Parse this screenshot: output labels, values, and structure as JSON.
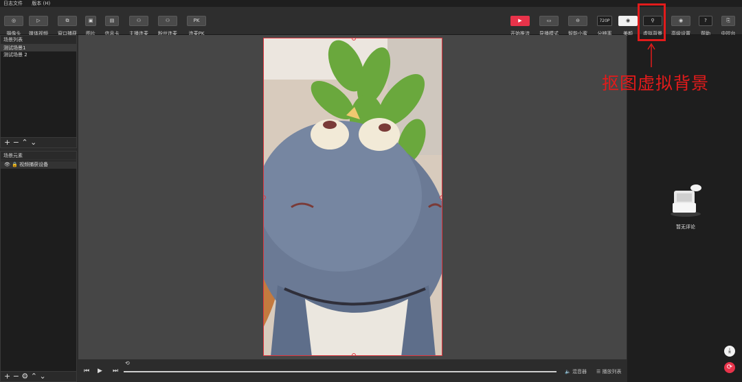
{
  "menu": [
    "日志文件",
    "版本 (H)"
  ],
  "toolbar_left": [
    {
      "label": "摄像头",
      "glyph": "◎"
    },
    {
      "label": "媒体视频",
      "glyph": "▷"
    },
    {
      "label": "窗口捕获",
      "glyph": "⧉"
    },
    {
      "label": "图片",
      "glyph": "▣"
    },
    {
      "label": "信息卡",
      "glyph": "▤"
    },
    {
      "label": "主播连麦",
      "glyph": "⚇"
    },
    {
      "label": "粉丝连麦",
      "glyph": "⚇"
    },
    {
      "label": "连麦PK",
      "glyph": "PK"
    }
  ],
  "toolbar_right": [
    {
      "label": "开始推流",
      "glyph": "▶",
      "style": "red"
    },
    {
      "label": "导播模式",
      "glyph": "▭",
      "style": ""
    },
    {
      "label": "智能小蜜",
      "glyph": "⊖",
      "style": ""
    },
    {
      "label": "分辨率",
      "glyph": "720P",
      "style": "dark"
    },
    {
      "label": "美颜",
      "glyph": "◉",
      "style": "white"
    },
    {
      "label": "虚拟背景",
      "glyph": "⚲",
      "style": "dark"
    },
    {
      "label": "高级设置",
      "glyph": "◉",
      "style": ""
    },
    {
      "label": "帮助",
      "glyph": "?",
      "style": "dark"
    },
    {
      "label": "中控台",
      "glyph": "⎘",
      "style": ""
    }
  ],
  "scenes": {
    "title": "场景列表",
    "items": [
      "测试场景1",
      "测试场景 2"
    ],
    "controls": "+ − ⌃ ⌄"
  },
  "sources": {
    "title": "场景元素",
    "items": [
      "视频捕获设备"
    ],
    "controls": "+ − ⚙ ⌃ ⌄"
  },
  "player": {
    "mixer": "混音器",
    "playlist": "播放列表"
  },
  "comments": {
    "empty": "暂无评论"
  },
  "annotation": {
    "text": "抠图虚拟背景",
    "color": "#e21b1b"
  }
}
